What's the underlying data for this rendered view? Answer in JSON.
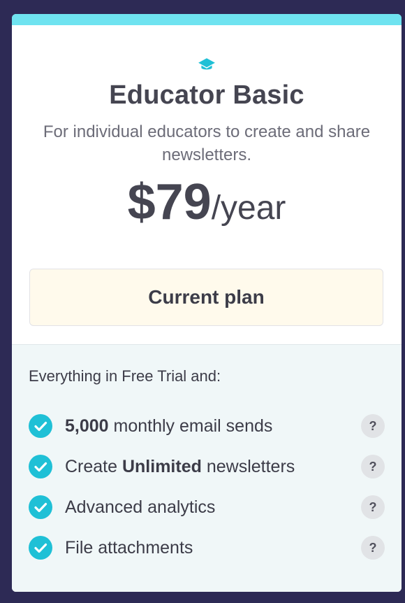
{
  "plan": {
    "icon": "graduation-cap-icon",
    "title": "Educator Basic",
    "description": "For individual educators to create and share newsletters.",
    "price_amount": "$79",
    "price_period": "/year",
    "button_label": "Current plan"
  },
  "features": {
    "intro": "Everything in Free Trial and:",
    "items": [
      {
        "pre": "",
        "bold": "5,000",
        "post": " monthly email sends",
        "help": "?"
      },
      {
        "pre": "Create ",
        "bold": "Unlimited",
        "post": " newsletters",
        "help": "?"
      },
      {
        "pre": "Advanced analytics",
        "bold": "",
        "post": "",
        "help": "?"
      },
      {
        "pre": "File attachments",
        "bold": "",
        "post": "",
        "help": "?"
      }
    ]
  },
  "colors": {
    "accent": "#6fe3f0",
    "check": "#1fc0d6",
    "background": "#2d2a55",
    "button_bg": "#fffaec",
    "features_bg": "#f0f7f8"
  }
}
